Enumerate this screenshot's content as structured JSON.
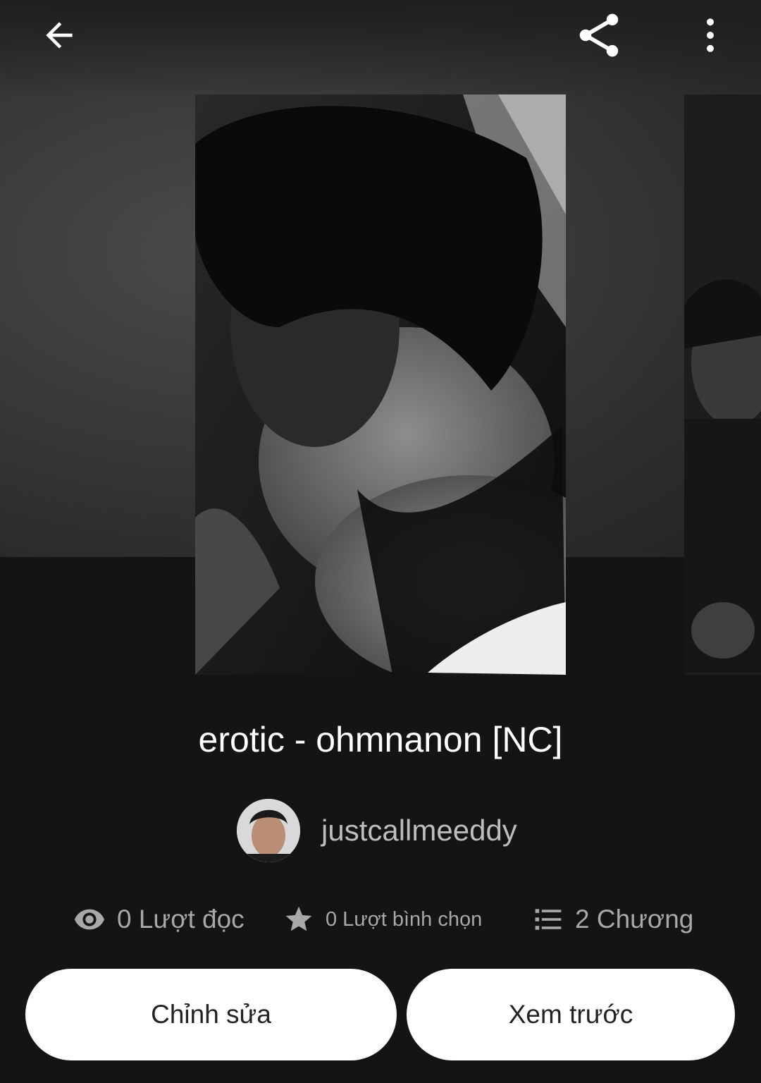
{
  "toolbar": {
    "back_icon": "arrow-left-icon",
    "share_icon": "share-icon",
    "more_icon": "more-vertical-icon"
  },
  "story": {
    "title": "erotic - ohmnanon [NC]",
    "author": "justcallmeeddy"
  },
  "stats": {
    "reads_icon": "eye-icon",
    "reads": "0 Lượt đọc",
    "votes_icon": "star-icon",
    "votes": "0 Lượt bình chọn",
    "chapters_icon": "list-icon",
    "chapters": "2 Chương"
  },
  "actions": {
    "edit": "Chỉnh sửa",
    "preview": "Xem trước"
  },
  "colors": {
    "background": "#141414",
    "button_bg": "#ffffff",
    "title_text": "#ffffff",
    "stat_text": "#a8a8a8"
  }
}
